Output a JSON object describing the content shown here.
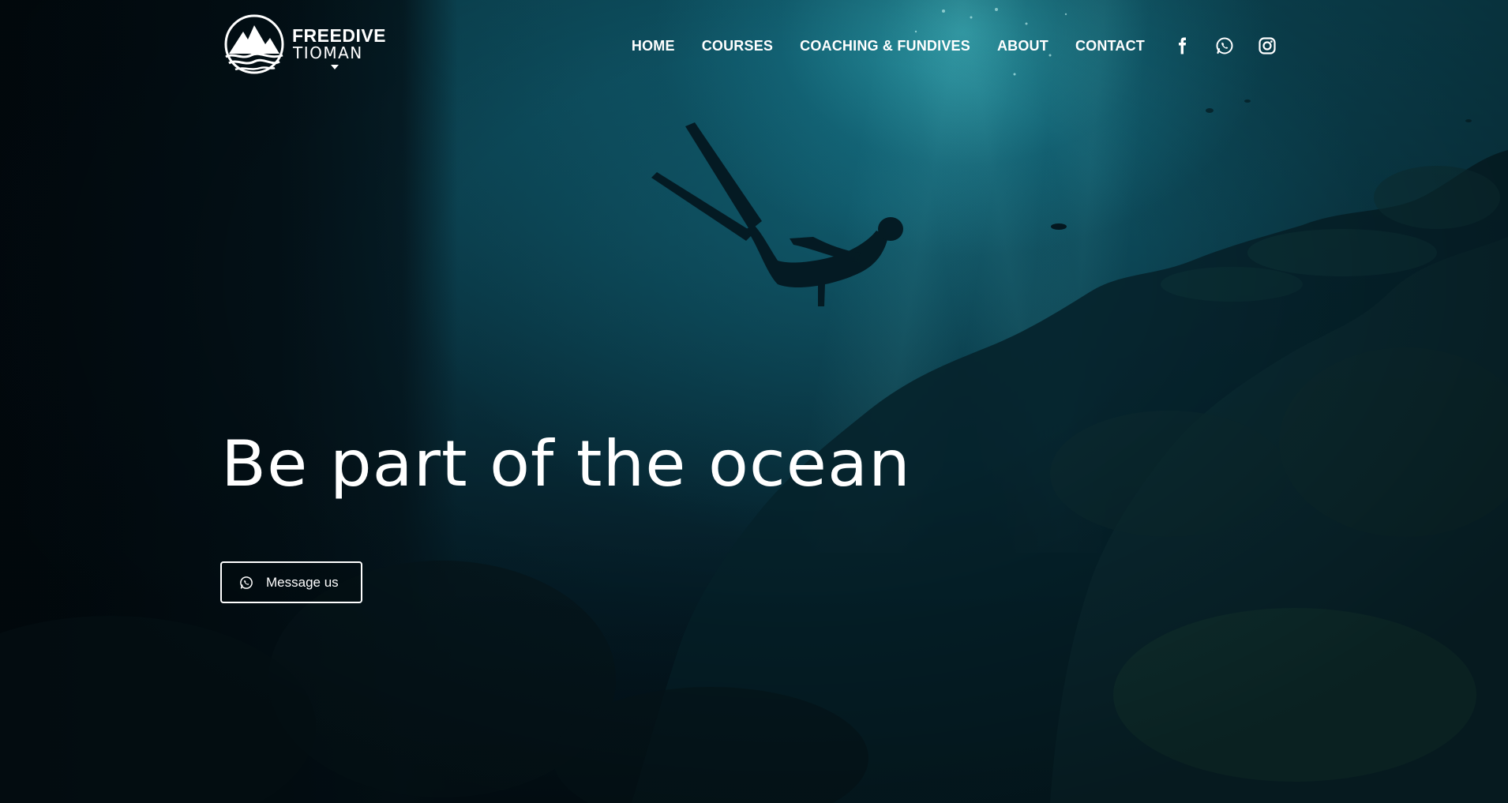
{
  "brand": {
    "word1": "FREEDIVE",
    "word2": "TIOMAN"
  },
  "nav": {
    "items": [
      {
        "label": "HOME"
      },
      {
        "label": "COURSES"
      },
      {
        "label": "COACHING & FUNDIVES"
      },
      {
        "label": "ABOUT"
      },
      {
        "label": "CONTACT"
      }
    ],
    "social_icons": [
      "facebook-icon",
      "whatsapp-icon",
      "instagram-icon"
    ]
  },
  "hero": {
    "headline": "Be part of the ocean",
    "cta": {
      "label": "Message us",
      "icon": "whatsapp-icon"
    }
  },
  "colors": {
    "text": "#ffffff",
    "water_light": "#40c8d2",
    "water_deep": "#03121a"
  }
}
